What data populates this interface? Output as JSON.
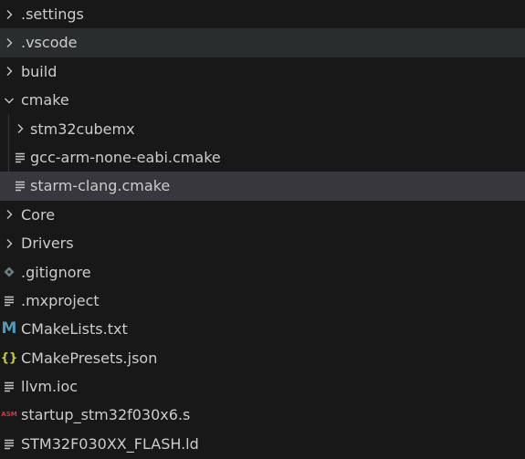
{
  "explorer": {
    "items": [
      {
        "label": ".settings",
        "kind": "folder",
        "expanded": false,
        "level": 0,
        "icon": "chevron-right-icon"
      },
      {
        "label": ".vscode",
        "kind": "folder",
        "expanded": false,
        "level": 0,
        "icon": "chevron-right-icon"
      },
      {
        "label": "build",
        "kind": "folder",
        "expanded": false,
        "level": 0,
        "icon": "chevron-right-icon"
      },
      {
        "label": "cmake",
        "kind": "folder",
        "expanded": true,
        "level": 0,
        "icon": "chevron-down-icon"
      },
      {
        "label": "stm32cubemx",
        "kind": "folder",
        "expanded": false,
        "level": 1,
        "icon": "chevron-right-icon"
      },
      {
        "label": "gcc-arm-none-eabi.cmake",
        "kind": "file",
        "level": 1,
        "icon": "lines-file-icon"
      },
      {
        "label": "starm-clang.cmake",
        "kind": "file",
        "level": 1,
        "icon": "lines-file-icon"
      },
      {
        "label": "Core",
        "kind": "folder",
        "expanded": false,
        "level": 0,
        "icon": "chevron-right-icon"
      },
      {
        "label": "Drivers",
        "kind": "folder",
        "expanded": false,
        "level": 0,
        "icon": "chevron-right-icon"
      },
      {
        "label": ".gitignore",
        "kind": "file",
        "level": 0,
        "icon": "git-diamond-icon"
      },
      {
        "label": ".mxproject",
        "kind": "file",
        "level": 0,
        "icon": "lines-file-icon"
      },
      {
        "label": "CMakeLists.txt",
        "kind": "file",
        "level": 0,
        "icon": "markdown-m-icon",
        "icon_text": "M"
      },
      {
        "label": "CMakePresets.json",
        "kind": "file",
        "level": 0,
        "icon": "json-braces-icon",
        "icon_text": "{}"
      },
      {
        "label": "llvm.ioc",
        "kind": "file",
        "level": 0,
        "icon": "lines-file-icon"
      },
      {
        "label": "startup_stm32f030x6.s",
        "kind": "file",
        "level": 0,
        "icon": "asm-icon",
        "icon_text": "ASM"
      },
      {
        "label": "STM32F030XX_FLASH.ld",
        "kind": "file",
        "level": 0,
        "icon": "lines-file-icon"
      }
    ]
  },
  "colors": {
    "background": "#181818",
    "text": "#cccccc",
    "hover_row": "#2a2d2e",
    "selected_row": "#37373d",
    "chevron": "#c5c5c5",
    "markdown_icon": "#519aba",
    "json_icon": "#cbcb41",
    "asm_icon": "#cc3e44",
    "git_icon": "#6d8086"
  }
}
